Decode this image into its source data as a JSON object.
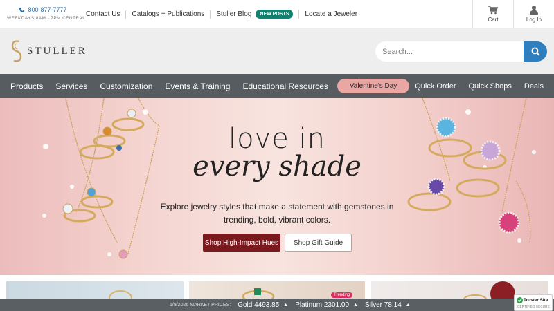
{
  "colors": {
    "accent_blue": "#2f7fbf",
    "nav_bg": "#565c60",
    "badge_green": "#13806f",
    "primary_button": "#7a1a1e",
    "valentine_pill": "#e9a6a3",
    "trending_badge": "#d62e5d"
  },
  "topbar": {
    "phone": "800-877-7777",
    "hours": "WEEKDAYS 8AM - 7PM CENTRAL",
    "links": {
      "contact": "Contact Us",
      "catalogs": "Catalogs + Publications",
      "blog": "Stuller Blog",
      "blog_badge": "NEW POSTS",
      "locate": "Locate a Jeweler"
    },
    "cart_label": "Cart",
    "login_label": "Log In"
  },
  "logo": {
    "text": "STULLER"
  },
  "search": {
    "placeholder": "Search..."
  },
  "nav": {
    "items": [
      "Products",
      "Services",
      "Customization",
      "Events & Training",
      "Educational Resources"
    ],
    "promo": "Valentine's Day",
    "right_items": [
      "Quick Order",
      "Quick Shops",
      "Deals"
    ]
  },
  "hero": {
    "title_line1": "love in",
    "title_line2": "every shade",
    "description": "Explore jewelry styles that make a statement with gemstones in trending, bold, vibrant colors.",
    "primary_cta": "Shop High-Impact Hues",
    "secondary_cta": "Shop Gift Guide"
  },
  "tiles": {
    "trending_badge": "Trending"
  },
  "ticker": {
    "label": "1/9/2026 MARKET PRICES:",
    "gold": "Gold 4493.85",
    "platinum": "Platinum 2301.00",
    "silver": "Silver 78.14"
  },
  "trusted": {
    "name": "TrustedSite",
    "subtitle": "CERTIFIED SECURE"
  }
}
